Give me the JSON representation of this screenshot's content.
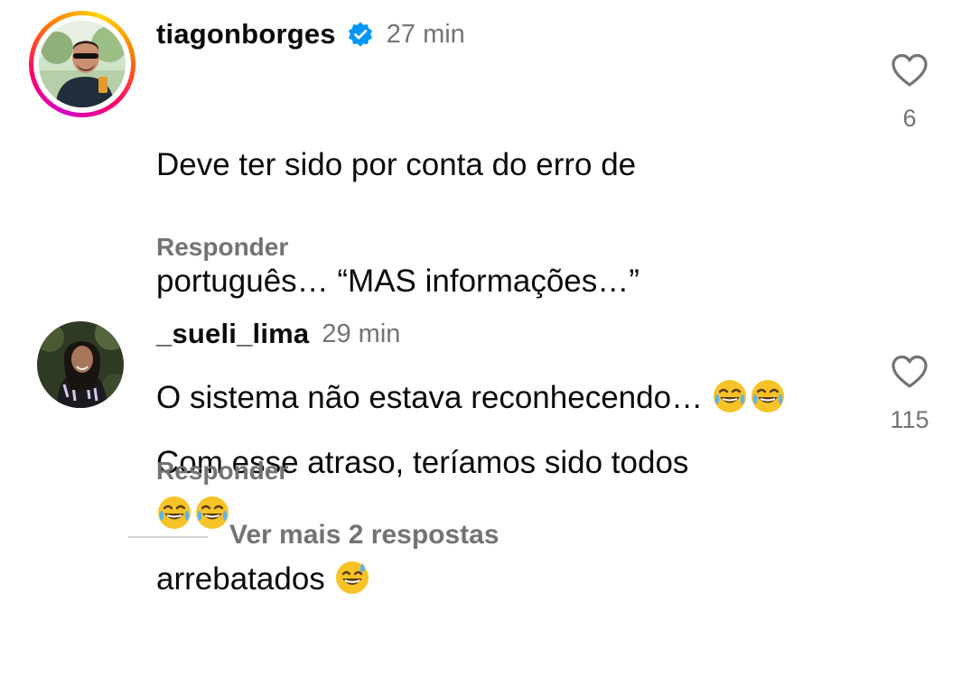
{
  "comments": [
    {
      "username": "tiagonborges",
      "verified": true,
      "time": "27 min",
      "lines": [
        "Deve ter sido por conta do erro de",
        "português… “MAS informações…”",
        "O sistema não estava reconhecendo…"
      ],
      "emojis_line3": [
        "tears-of-joy-emoji",
        "tears-of-joy-emoji"
      ],
      "emojis_line4": [
        "tears-of-joy-emoji",
        "tears-of-joy-emoji"
      ],
      "reply_label": "Responder",
      "likes": "6",
      "avatar_ring": true
    },
    {
      "username": "_sueli_lima",
      "verified": false,
      "time": "29 min",
      "lines": [
        "Com esse atraso, teríamos sido todos",
        "arrebatados"
      ],
      "emojis_line2": [
        "grinning-sweat-emoji"
      ],
      "reply_label": "Responder",
      "likes": "115",
      "avatar_ring": false
    }
  ],
  "more_replies_label": "Ver mais 2 respostas",
  "colors": {
    "text": "#0a0a0a",
    "secondary": "#737373",
    "verified_blue": "#0095f6",
    "divider": "#d4d4d4"
  },
  "icons": [
    "heart-outline-icon",
    "verified-badge-icon"
  ]
}
